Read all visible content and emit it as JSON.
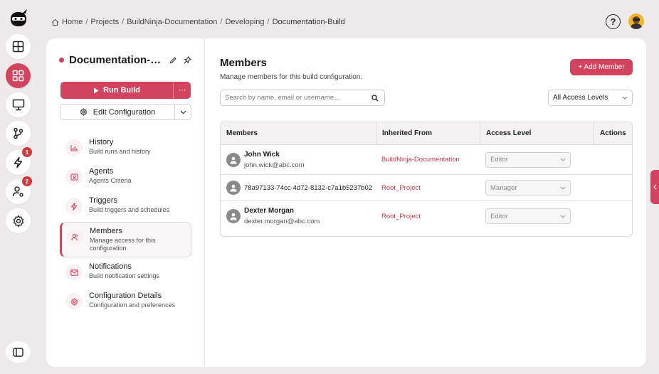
{
  "breadcrumb": {
    "items": [
      "Home",
      "Projects",
      "BuildNinja-Documentation",
      "Developing",
      "Documentation-Build"
    ],
    "separator": "/"
  },
  "header": {
    "help_label": "?"
  },
  "rail": {
    "items": [
      {
        "name": "dashboard-icon"
      },
      {
        "name": "grid-icon",
        "active": true
      },
      {
        "name": "monitor-icon"
      },
      {
        "name": "branch-icon"
      },
      {
        "name": "bolt-icon",
        "badge": "1"
      },
      {
        "name": "user-gear-icon",
        "badge": "2"
      },
      {
        "name": "settings-icon"
      }
    ]
  },
  "build": {
    "title": "Documentation-Build",
    "run_label": "Run Build",
    "more_label": "···",
    "edit_label": "Edit Configuration"
  },
  "nav": [
    {
      "label": "History",
      "sub": "Build runs and history"
    },
    {
      "label": "Agents",
      "sub": "Agents Criteria"
    },
    {
      "label": "Triggers",
      "sub": "Build triggers and schedules"
    },
    {
      "label": "Members",
      "sub": "Manage access for this configuration",
      "active": true
    },
    {
      "label": "Notifications",
      "sub": "Build notification settings"
    },
    {
      "label": "Configuration Details",
      "sub": "Configuration and preferences"
    }
  ],
  "main": {
    "title": "Members",
    "subtitle": "Manage members for this build configuration.",
    "add_label": "+ Add Member",
    "search_placeholder": "Search by name, email or username...",
    "filter_value": "All Access Levels"
  },
  "table": {
    "columns": [
      "Members",
      "Inherited From",
      "Access Level",
      "Actions"
    ],
    "rows": [
      {
        "name": "John Wick",
        "email": "john.wick@abc.com",
        "inherited": "BuildNinja-Documentation",
        "access": "Editor"
      },
      {
        "id": "78a97133-74cc-4d72-8132-c7a1b5237b02",
        "inherited": "Root_Project",
        "access": "Manager"
      },
      {
        "name": "Dexter Morgan",
        "email": "dexter.morgan@abc.com",
        "inherited": "Root_Project",
        "access": "Editor"
      }
    ]
  },
  "colors": {
    "accent": "#d2435f",
    "badge": "#d13a3a",
    "link": "#c8364f"
  }
}
